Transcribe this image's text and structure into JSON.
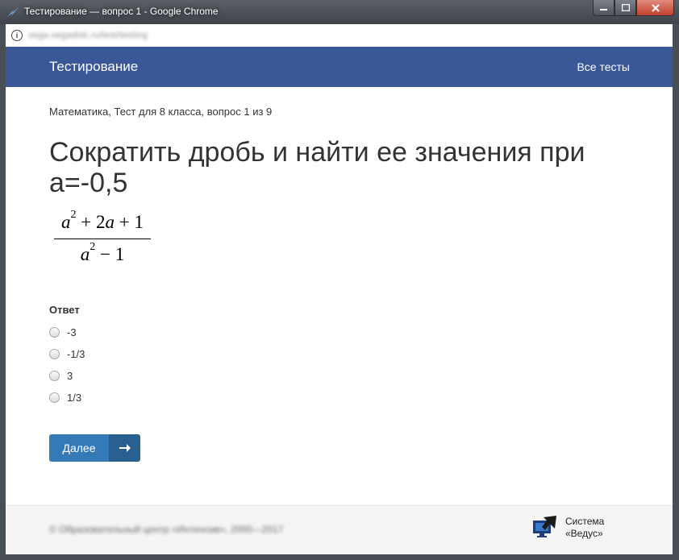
{
  "window": {
    "title": "Тестирование — вопрос 1 - Google Chrome",
    "url": "vega.vegadisk.ru/test/testing"
  },
  "navbar": {
    "brand": "Тестирование",
    "all_tests": "Все тесты"
  },
  "breadcrumb": "Математика, Тест для 8 класса, вопрос 1 из 9",
  "question": {
    "text": "Сократить дробь и найти ее значения при а=-0,5"
  },
  "answer": {
    "label": "Ответ",
    "options": [
      "-3",
      "-1/3",
      "3",
      "1/3"
    ]
  },
  "next_button": {
    "label": "Далее"
  },
  "footer": {
    "copyright": "© Образовательный центр «Интенсив», 2000—2017",
    "logo_line1": "Система",
    "logo_line2": "«Ведус»"
  },
  "colors": {
    "navbar": "#3a5898",
    "button": "#337ab7",
    "button_dark": "#286090"
  }
}
